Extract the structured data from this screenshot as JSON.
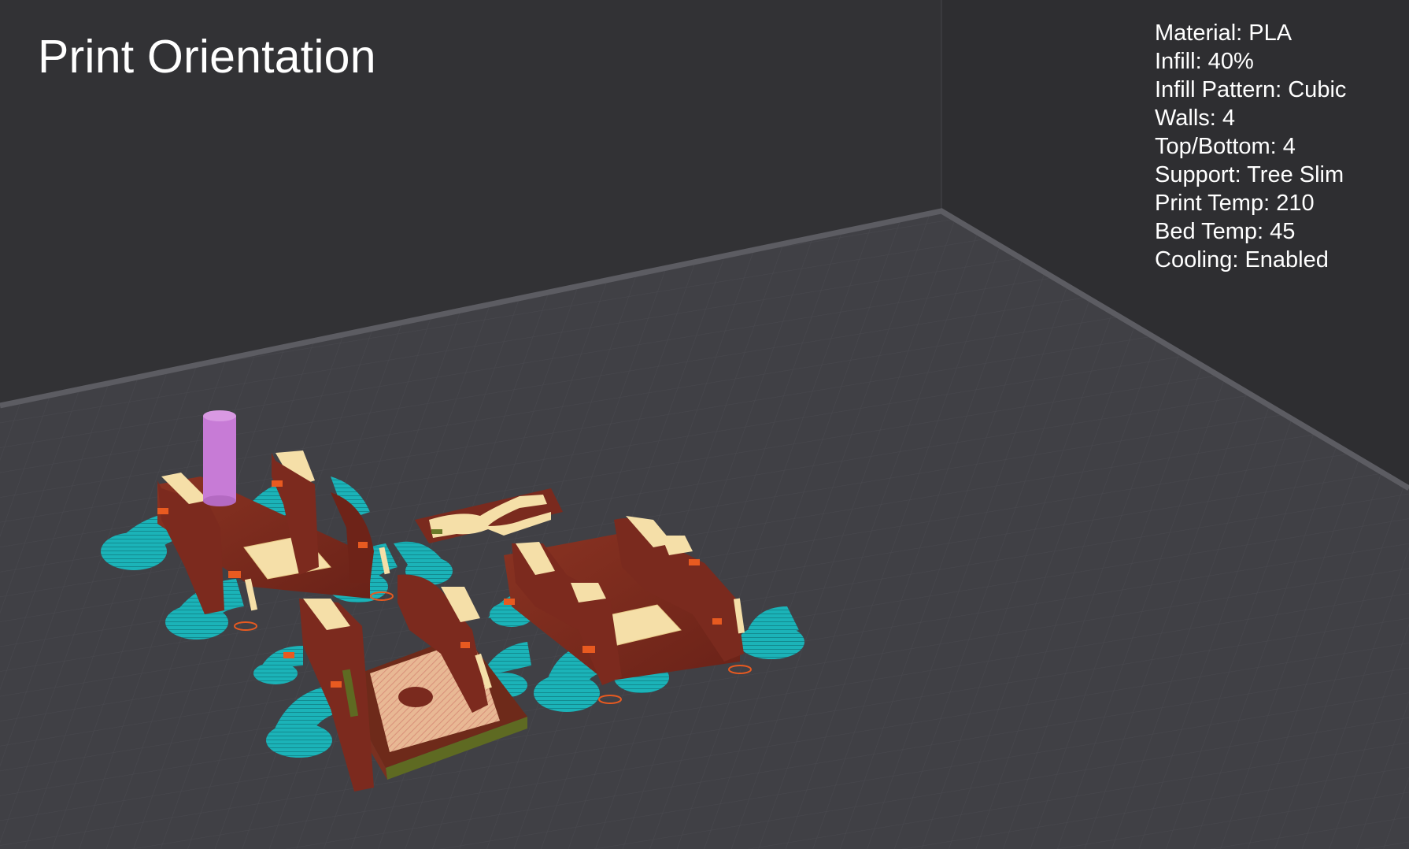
{
  "title": "Print Orientation",
  "settings": [
    "Material: PLA",
    "Infill: 40%",
    "Infill Pattern: Cubic",
    "Walls: 4",
    "Top/Bottom: 4",
    "Support: Tree Slim",
    "Print Temp: 210",
    "Bed Temp: 45",
    "Cooling: Enabled"
  ],
  "colors": {
    "background": "#303033",
    "bed": "#404045",
    "bed_edge": "#5a5a60",
    "wall": "#7a2a1e",
    "top_skin": "#f5dfa8",
    "support": "#1bb3b8",
    "overhang": "#e85a20",
    "travel_cylinder": "#cc80d9",
    "infill": "#6b6b2a"
  },
  "icons": {
    "preview": "sliced-model-preview"
  }
}
